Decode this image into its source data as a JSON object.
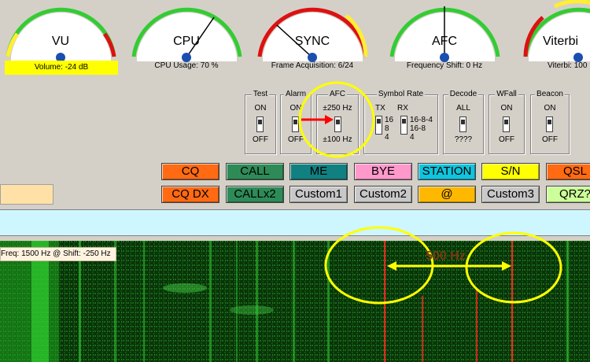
{
  "meters": [
    {
      "title": "VU",
      "caption": "Volume: -24 dB"
    },
    {
      "title": "CPU",
      "caption": "CPU Usage: 70 %"
    },
    {
      "title": "SYNC",
      "caption": "Frame Acquisition: 6/24"
    },
    {
      "title": "AFC",
      "caption": "Frequency Shift: 0 Hz"
    },
    {
      "title": "Viterbi",
      "caption": "Viterbi: 100"
    }
  ],
  "switches": {
    "test": {
      "title": "Test",
      "top": "ON",
      "bottom": "OFF"
    },
    "alarm": {
      "title": "Alarm",
      "top": "ON",
      "bottom": "OFF"
    },
    "afc": {
      "title": "AFC",
      "top": "±250 Hz",
      "bottom": "±100 Hz"
    },
    "symbol_rate": {
      "title": "Symbol Rate",
      "tx": "TX",
      "rx": "RX",
      "tx_opts": [
        "16",
        "8",
        "4"
      ],
      "rx_opts": [
        "16-8-4",
        "16-8",
        "4"
      ]
    },
    "decode": {
      "title": "Decode",
      "top": "ALL",
      "bottom": "????"
    },
    "wfall": {
      "title": "WFall",
      "top": "ON",
      "bottom": "OFF"
    },
    "beacon": {
      "title": "Beacon",
      "top": "ON",
      "bottom": "OFF"
    }
  },
  "macro_row1": [
    "CQ",
    "CALL",
    "ME",
    "BYE",
    "STATION",
    "S/N",
    "QSL"
  ],
  "macro_row2": [
    "CQ DX",
    "CALLx2",
    "Custom1",
    "Custom2",
    "@",
    "Custom3",
    "QRZ?"
  ],
  "waterfall": {
    "freq_label": "Freq: 1500 Hz @ Shift: -250 Hz",
    "span_label": "500 Hz"
  },
  "colors": {
    "highlight": "#ffff00",
    "annotation_arrow": "#ff0000",
    "gauge_green": "#33cc33",
    "gauge_red": "#dd1111",
    "gauge_yellow": "#ffee33",
    "needle": "#000000",
    "waterfall": "#0b3a0b"
  }
}
